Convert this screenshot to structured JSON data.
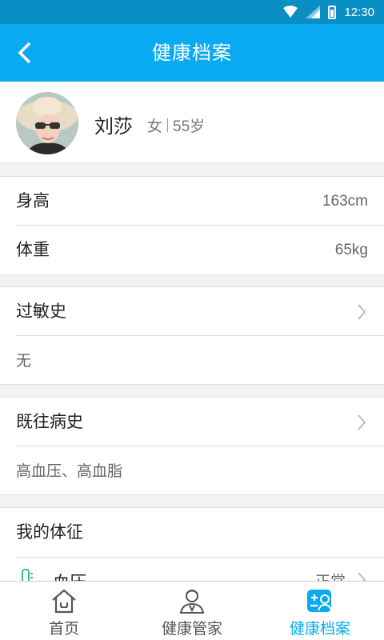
{
  "status_bar": {
    "time": "12:30"
  },
  "header": {
    "title": "健康档案"
  },
  "profile": {
    "name": "刘莎",
    "gender": "女",
    "age": "55岁"
  },
  "body_info": [
    {
      "label": "身高",
      "value": "163cm"
    },
    {
      "label": "体重",
      "value": "65kg"
    }
  ],
  "allergy": {
    "label": "过敏史",
    "value": "无"
  },
  "history": {
    "label": "既往病史",
    "value": "高血压、高血脂"
  },
  "vitals": {
    "label": "我的体征",
    "first_item": {
      "label": "血压",
      "value": "正常"
    }
  },
  "bottom_nav": [
    {
      "label": "首页",
      "icon": "home-icon"
    },
    {
      "label": "健康管家",
      "icon": "doctor-icon"
    },
    {
      "label": "健康档案",
      "icon": "health-record-icon",
      "active": true
    }
  ],
  "colors": {
    "primary": "#0aaaf2",
    "status_bar": "#0a8fc4"
  }
}
